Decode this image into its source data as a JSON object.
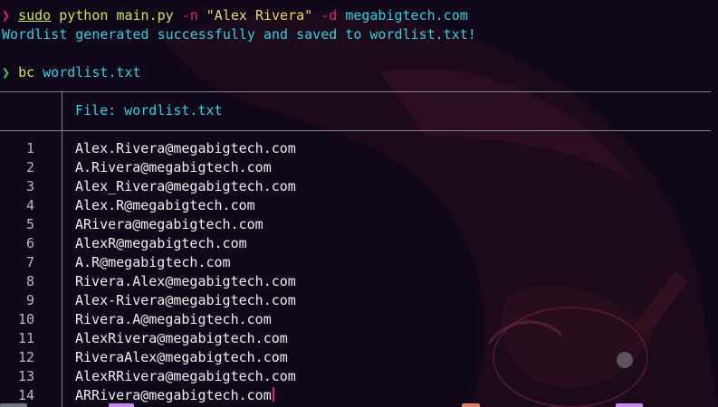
{
  "terminal": {
    "cmd1": {
      "prompt_symbol": "❯",
      "sudo": "sudo",
      "program": "python",
      "script": "main.py",
      "flag_n": "-n",
      "name_arg": "\"Alex Rivera\"",
      "flag_d": "-d",
      "domain_arg": "megabigtech.com"
    },
    "output1": "Wordlist generated successfully and saved to wordlist.txt!",
    "cmd2": {
      "prompt_symbol": "❯",
      "program": "bc",
      "arg": "wordlist.txt"
    },
    "file_view": {
      "header": "File: wordlist.txt",
      "lines": [
        {
          "n": "1",
          "text": "Alex.Rivera@megabigtech.com"
        },
        {
          "n": "2",
          "text": "A.Rivera@megabigtech.com"
        },
        {
          "n": "3",
          "text": "Alex_Rivera@megabigtech.com"
        },
        {
          "n": "4",
          "text": "Alex.R@megabigtech.com"
        },
        {
          "n": "5",
          "text": "ARivera@megabigtech.com"
        },
        {
          "n": "6",
          "text": "AlexR@megabigtech.com"
        },
        {
          "n": "7",
          "text": "A.R@megabigtech.com"
        },
        {
          "n": "8",
          "text": "Rivera.Alex@megabigtech.com"
        },
        {
          "n": "9",
          "text": "Alex-Rivera@megabigtech.com"
        },
        {
          "n": "10",
          "text": "Rivera.A@megabigtech.com"
        },
        {
          "n": "11",
          "text": "AlexRivera@megabigtech.com"
        },
        {
          "n": "12",
          "text": "RiveraAlex@megabigtech.com"
        },
        {
          "n": "13",
          "text": "AlexRRivera@megabigtech.com"
        },
        {
          "n": "14",
          "text": "ARRivera@megabigtech.com"
        }
      ]
    }
  },
  "colors": {
    "background": "#120a1c",
    "accent_pink": "#e0245e",
    "prompt_green": "#38d24f",
    "cyan": "#2fd0e0",
    "string_yellow": "#e8d96a"
  }
}
